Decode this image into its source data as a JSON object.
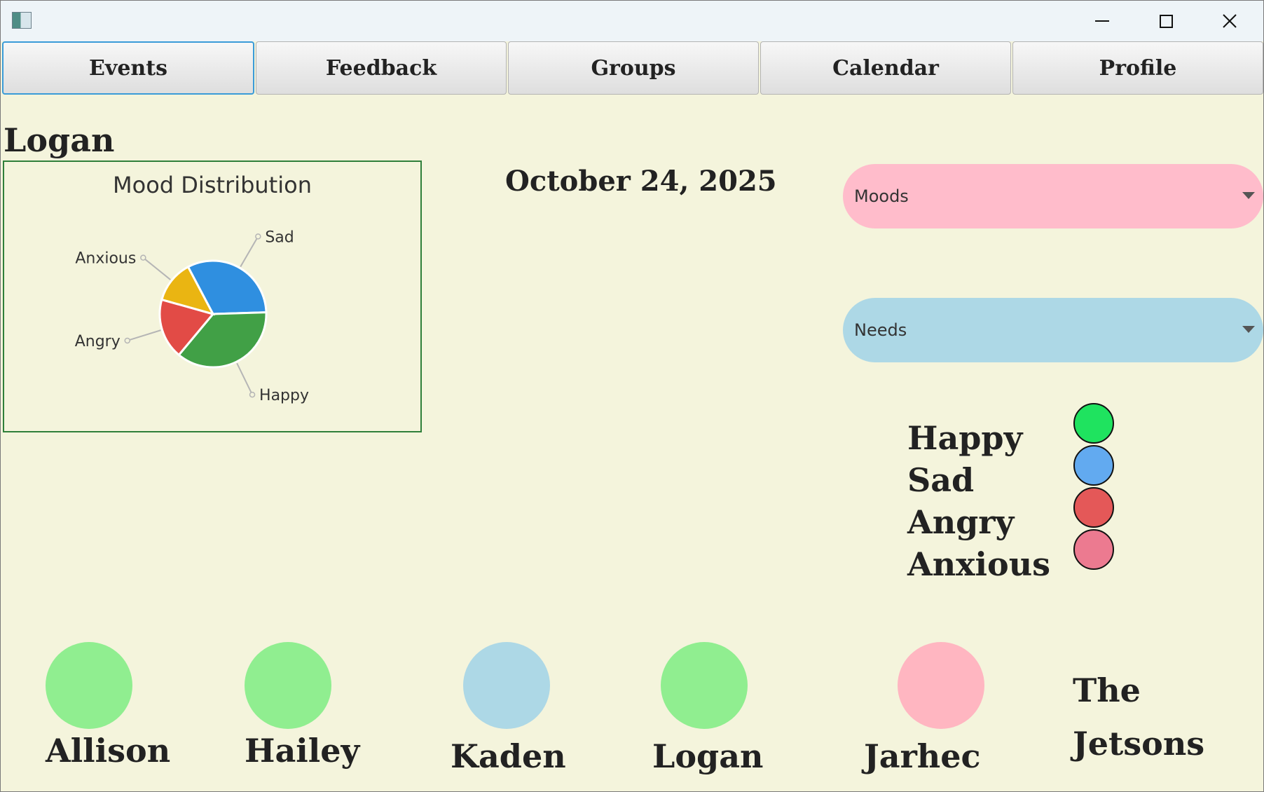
{
  "tabs": [
    {
      "label": "Events",
      "active": true
    },
    {
      "label": "Feedback",
      "active": false
    },
    {
      "label": "Groups",
      "active": false
    },
    {
      "label": "Calendar",
      "active": false
    },
    {
      "label": "Profile",
      "active": false
    }
  ],
  "user_name": "Logan",
  "date": "October 24, 2025",
  "chart_data": {
    "type": "pie",
    "title": "Mood Distribution",
    "slices": [
      {
        "label": "Sad",
        "value": 30,
        "color": "#2f8fe0"
      },
      {
        "label": "Happy",
        "value": 34,
        "color": "#41a046"
      },
      {
        "label": "Angry",
        "value": 17,
        "color": "#e24b46"
      },
      {
        "label": "Anxious",
        "value": 12,
        "color": "#eab512"
      }
    ]
  },
  "dropdowns": {
    "moods": {
      "label": "Moods",
      "color": "#ffbccb"
    },
    "needs": {
      "label": "Needs",
      "color": "#add8e6"
    }
  },
  "mood_legend": [
    {
      "label": "Happy",
      "color": "#1fe35f"
    },
    {
      "label": "Sad",
      "color": "#62aaf0"
    },
    {
      "label": "Angry",
      "color": "#e45858"
    },
    {
      "label": "Anxious",
      "color": "#ec7a90"
    }
  ],
  "members": [
    {
      "name": "Allison",
      "color": "#90ee90"
    },
    {
      "name": "Hailey",
      "color": "#90ee90"
    },
    {
      "name": "Kaden",
      "color": "#add8e6"
    },
    {
      "name": "Logan",
      "color": "#90ee90"
    },
    {
      "name": "Jarhec",
      "color": "#ffb6c1"
    }
  ],
  "group_name": {
    "line1": "The",
    "line2": "Jetsons"
  }
}
